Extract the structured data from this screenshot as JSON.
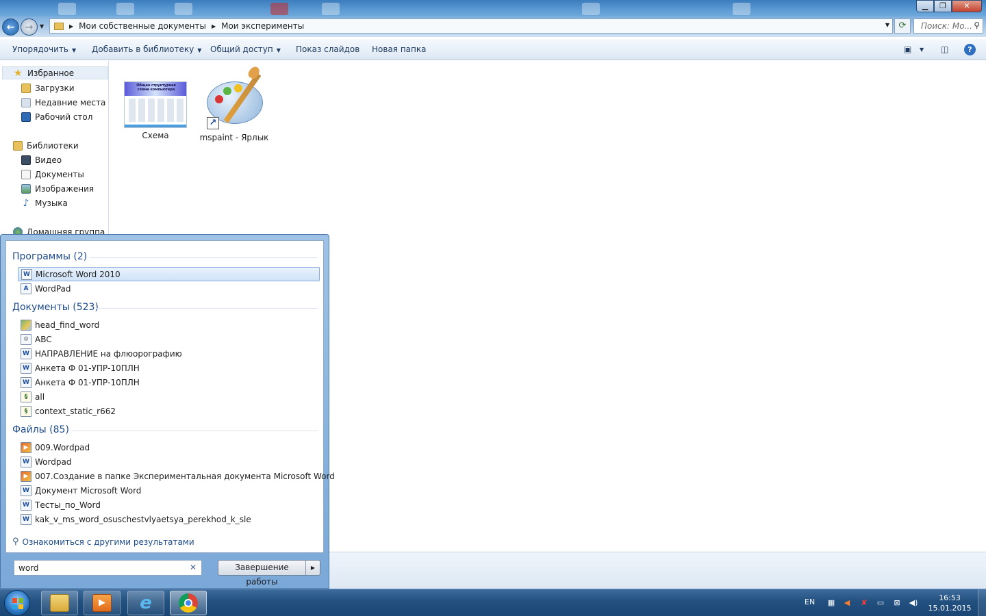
{
  "explorer": {
    "breadcrumb": [
      "Мои собственные документы",
      "Мои эксперименты"
    ],
    "search_placeholder": "Поиск: Мо...",
    "toolbar": {
      "organize": "Упорядочить",
      "add_to_library": "Добавить в библиотеку",
      "share": "Общий доступ",
      "slideshow": "Показ слайдов",
      "new_folder": "Новая папка"
    },
    "nav": {
      "favorites": "Избранное",
      "downloads": "Загрузки",
      "recent": "Недавние места",
      "desktop": "Рабочий стол",
      "libraries": "Библиотеки",
      "video": "Видео",
      "documents": "Документы",
      "images": "Изображения",
      "music": "Музыка",
      "homegroup": "Домашняя группа"
    },
    "files": [
      {
        "name": "Схема",
        "icon": "document-thumbnail",
        "thumb_title": "Общая структурная схема компьютера"
      },
      {
        "name": "mspaint - Ярлык",
        "icon": "paint-palette-shortcut-icon"
      }
    ]
  },
  "start_menu": {
    "programs": {
      "header": "Программы (2)",
      "items": [
        "Microsoft Word 2010",
        "WordPad"
      ]
    },
    "documents": {
      "header": "Документы (523)",
      "items": [
        "head_find_word",
        "ABC",
        "НАПРАВЛЕНИЕ на флюорографию",
        "Анкета Ф 01-УПР-10ПЛН",
        "Анкета Ф 01-УПР-10ПЛН",
        "all",
        "context_static_r662"
      ]
    },
    "files": {
      "header": "Файлы (85)",
      "items": [
        "009.Wordpad",
        "Wordpad",
        "007.Создание в папке Экспериментальная документа Microsoft Word",
        "Документ Microsoft Word",
        "Тесты_по_Word",
        "kak_v_ms_word_osuschestvlyaetsya_perekhod_k_sle"
      ]
    },
    "more_results": "Ознакомиться с другими результатами",
    "search_value": "word",
    "shutdown_label": "Завершение работы"
  },
  "taskbar": {
    "lang": "EN",
    "time": "16:53",
    "date": "15.01.2015"
  },
  "colors": {
    "accent": "#1e4b8a",
    "taskbar": "#22507f",
    "selection": "#cfe3f8"
  }
}
